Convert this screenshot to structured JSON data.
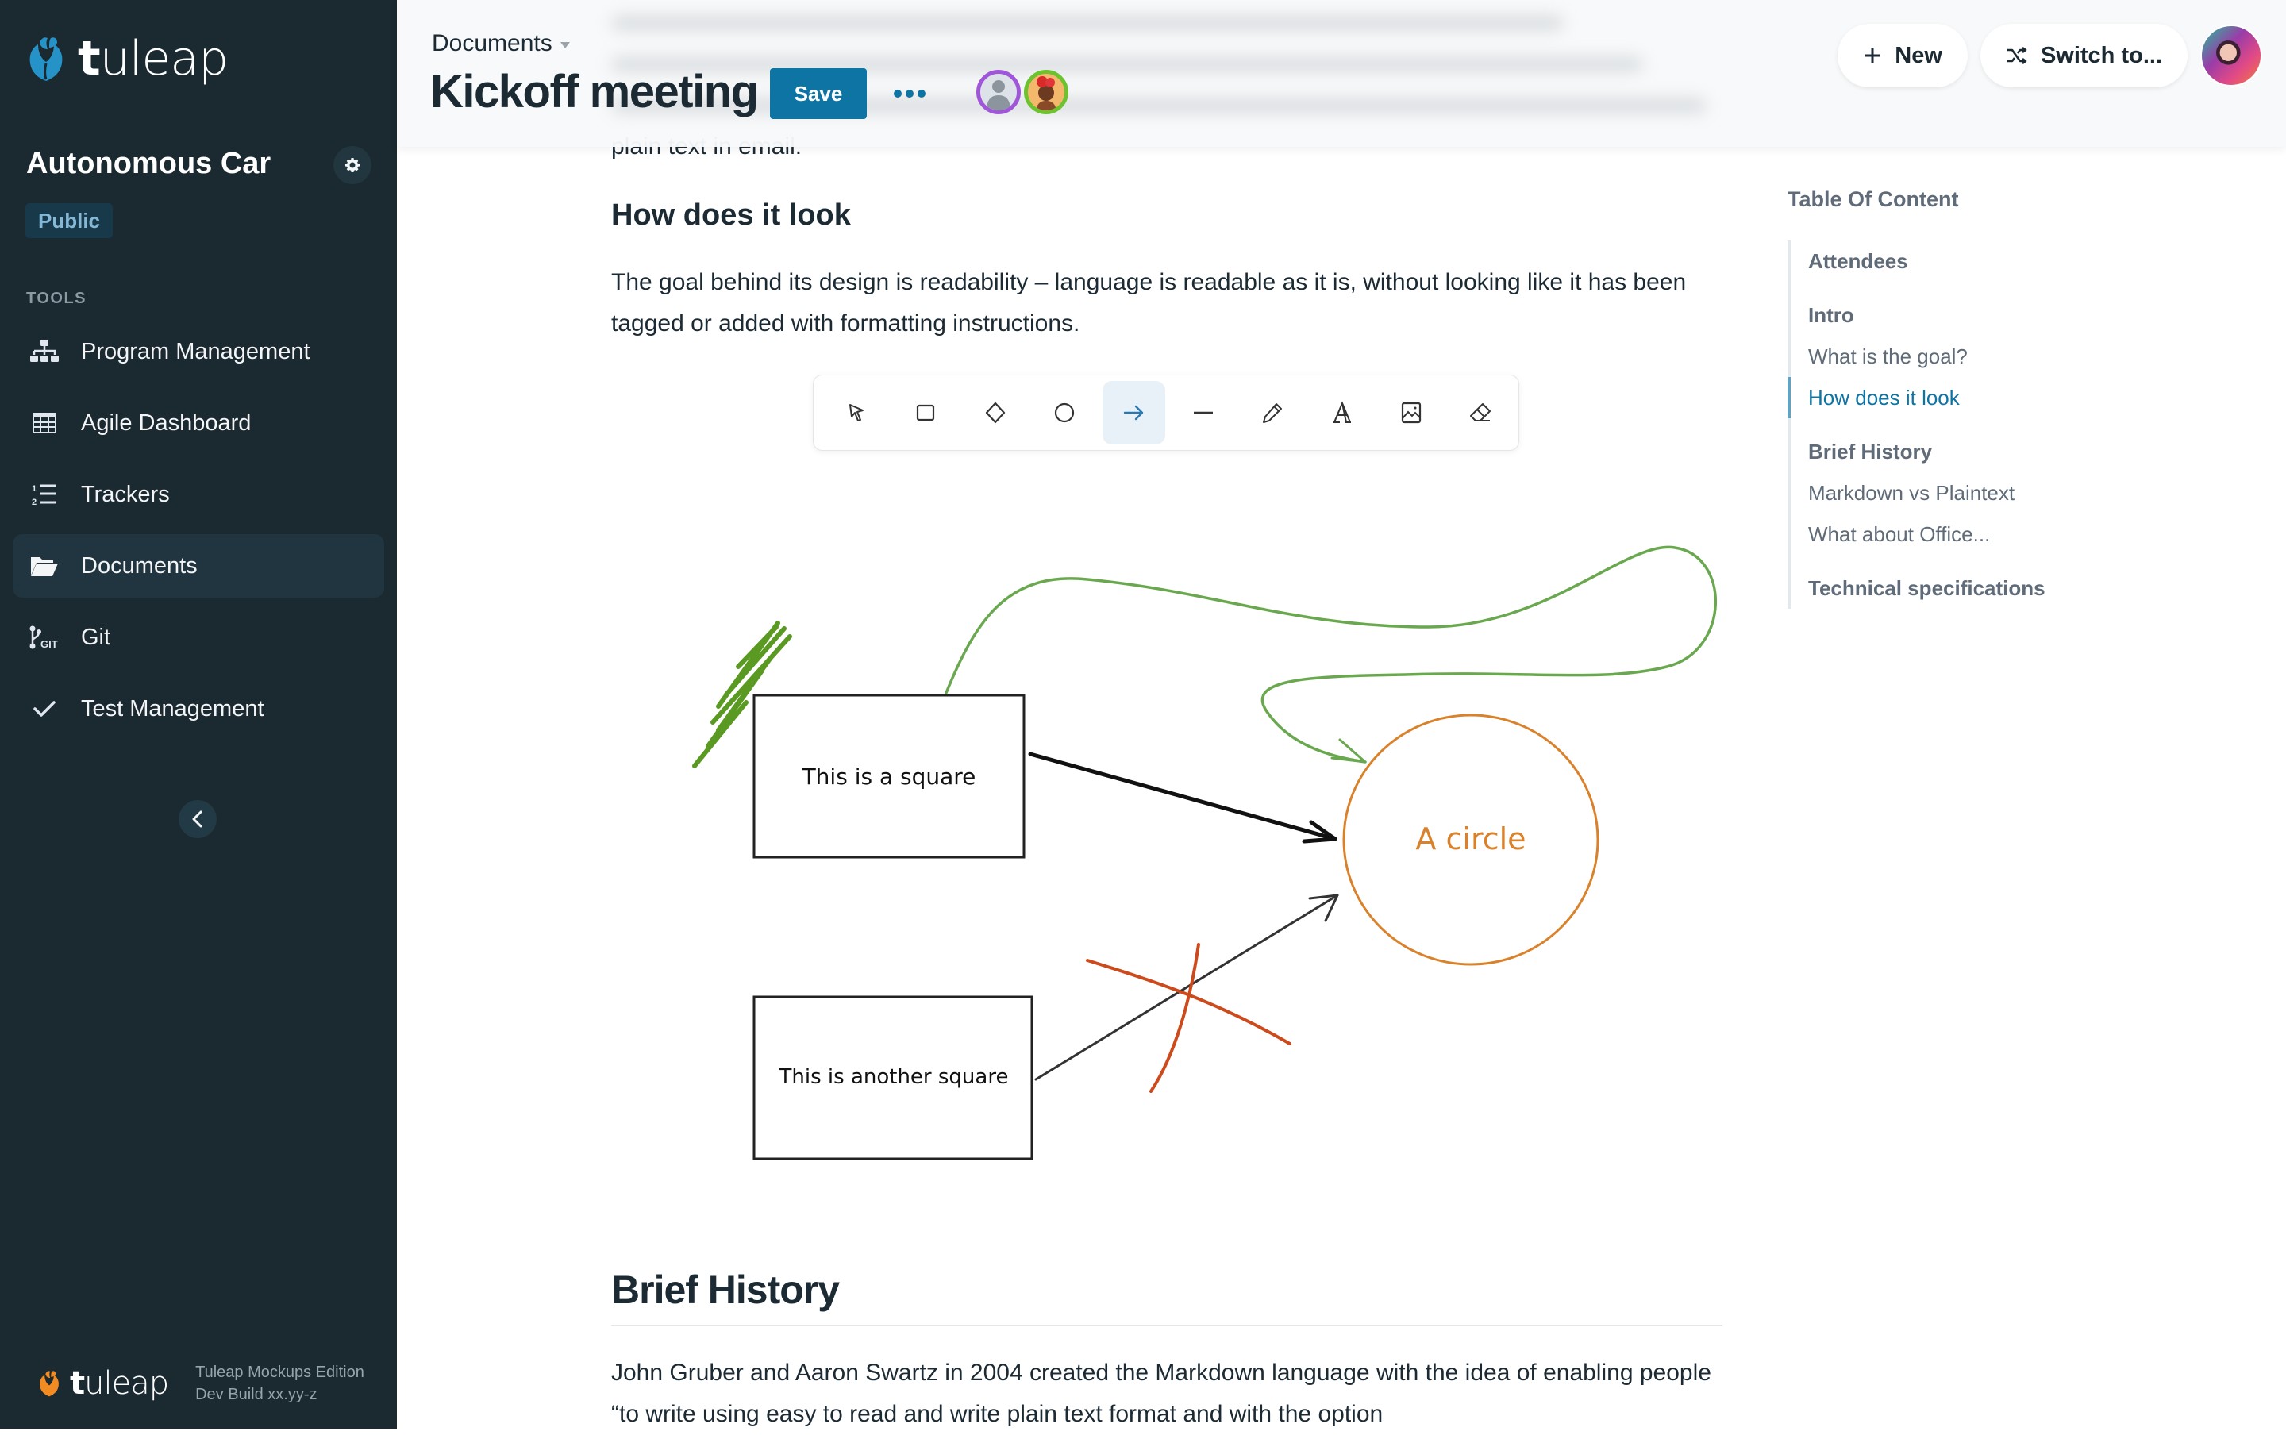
{
  "sidebar": {
    "brand": {
      "prefix": "t",
      "rest": "uleap"
    },
    "project_name": "Autonomous Car",
    "visibility_badge": "Public",
    "tools_title": "TOOLS",
    "items": [
      {
        "label": "Program Management",
        "icon": "sitemap-icon",
        "active": false
      },
      {
        "label": "Agile Dashboard",
        "icon": "table-icon",
        "active": false
      },
      {
        "label": "Trackers",
        "icon": "list-ol-icon",
        "active": false
      },
      {
        "label": "Documents",
        "icon": "folder-open-icon",
        "active": true
      },
      {
        "label": "Git",
        "icon": "git-icon",
        "active": false
      },
      {
        "label": "Test Management",
        "icon": "check-icon",
        "active": false
      }
    ],
    "footer": {
      "brand_prefix": "t",
      "brand_rest": "uleap",
      "edition": "Tuleap Mockups Edition",
      "build": "Dev Build xx.yy-z"
    }
  },
  "header": {
    "breadcrumb": "Documents",
    "title": "Kickoff meeting",
    "save_label": "Save",
    "more_icon": "ellipsis-icon",
    "new_label": "New",
    "switch_label": "Switch to..."
  },
  "colors": {
    "sidebar_bg": "#1b2931",
    "accent": "#0e74a3",
    "drawing_green": "#6aa84f",
    "drawing_orange": "#d9822b",
    "drawing_red": "#cc4a1c"
  },
  "content": {
    "above_text": "plain text in email.",
    "section_heading": "How does it look",
    "section_paragraph": "The goal behind its design is readability – language is readable as it is, without looking like it has been tagged or added with formatting instructions.",
    "drawing_tools": [
      {
        "name": "select",
        "icon": "cursor-icon",
        "active": false
      },
      {
        "name": "rectangle",
        "icon": "rectangle-icon",
        "active": false
      },
      {
        "name": "diamond",
        "icon": "diamond-icon",
        "active": false
      },
      {
        "name": "ellipse",
        "icon": "circle-icon",
        "active": false
      },
      {
        "name": "arrow",
        "icon": "arrow-right-icon",
        "active": true
      },
      {
        "name": "line",
        "icon": "line-icon",
        "active": false
      },
      {
        "name": "draw",
        "icon": "pencil-icon",
        "active": false
      },
      {
        "name": "text",
        "icon": "text-icon",
        "active": false
      },
      {
        "name": "image",
        "icon": "image-icon",
        "active": false
      },
      {
        "name": "eraser",
        "icon": "eraser-icon",
        "active": false
      }
    ],
    "drawing": {
      "square1_label": "This is a square",
      "square2_label": "This is another square",
      "circle_label": "A circle"
    },
    "next_heading": "Brief History",
    "next_paragraph": "John Gruber and Aaron Swartz in 2004 created the Markdown language with the idea of enabling people “to write using easy to read and write plain text format and with the option"
  },
  "toc": {
    "title": "Table Of Content",
    "items": [
      {
        "label": "Attendees",
        "level": 1,
        "current": false
      },
      {
        "label": "Intro",
        "level": 1,
        "current": false
      },
      {
        "label": "What is the goal?",
        "level": 2,
        "current": false
      },
      {
        "label": "How does it look",
        "level": 2,
        "current": true
      },
      {
        "label": "Brief History",
        "level": 1,
        "current": false
      },
      {
        "label": "Markdown vs Plaintext",
        "level": 2,
        "current": false
      },
      {
        "label": "What about Office...",
        "level": 2,
        "current": false
      },
      {
        "label": "Technical specifications",
        "level": 1,
        "current": false
      }
    ]
  }
}
